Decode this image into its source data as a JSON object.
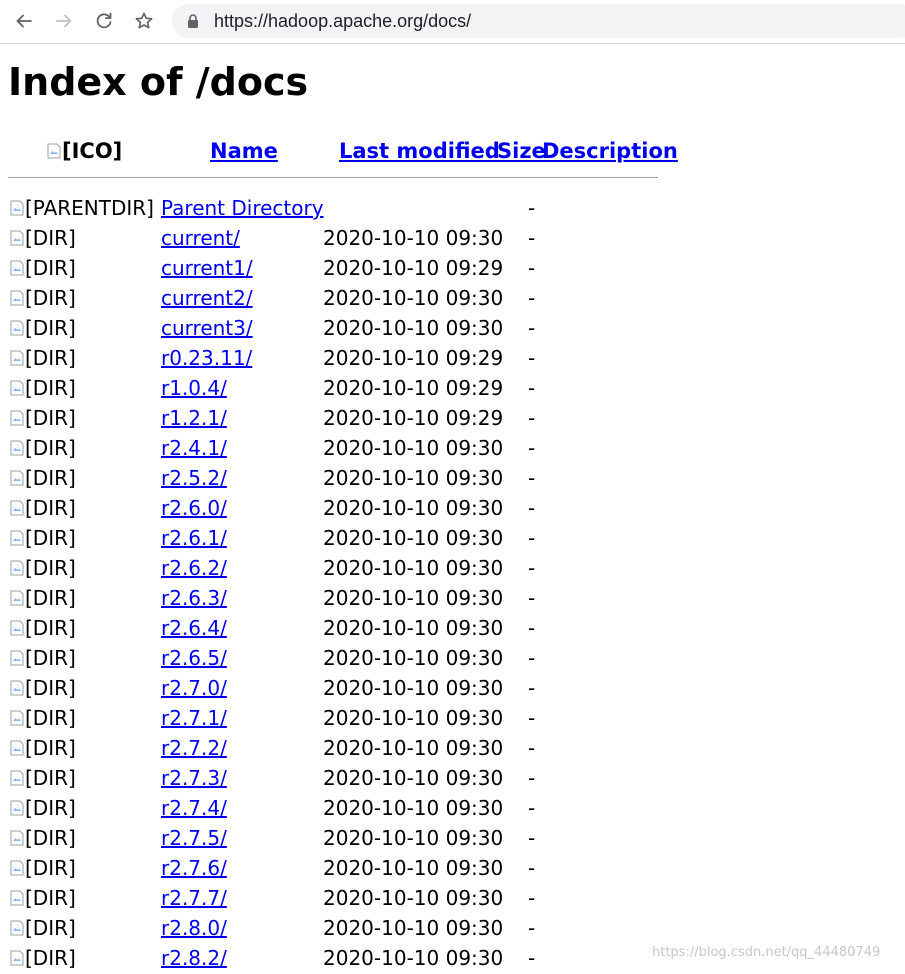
{
  "browser": {
    "url": "https://hadoop.apache.org/docs/"
  },
  "page": {
    "title": "Index of /docs",
    "header": {
      "icon_alt": "[ICO]",
      "name": "Name",
      "last_modified": "Last modified",
      "size": "Size",
      "description": "Description"
    },
    "rows": [
      {
        "icon": "[PARENTDIR]",
        "name": "Parent Directory",
        "date": "",
        "size": "-"
      },
      {
        "icon": "[DIR]",
        "name": "current/",
        "date": "2020-10-10 09:30",
        "size": "-"
      },
      {
        "icon": "[DIR]",
        "name": "current1/",
        "date": "2020-10-10 09:29",
        "size": "-"
      },
      {
        "icon": "[DIR]",
        "name": "current2/",
        "date": "2020-10-10 09:30",
        "size": "-"
      },
      {
        "icon": "[DIR]",
        "name": "current3/",
        "date": "2020-10-10 09:30",
        "size": "-"
      },
      {
        "icon": "[DIR]",
        "name": "r0.23.11/",
        "date": "2020-10-10 09:29",
        "size": "-"
      },
      {
        "icon": "[DIR]",
        "name": "r1.0.4/",
        "date": "2020-10-10 09:29",
        "size": "-"
      },
      {
        "icon": "[DIR]",
        "name": "r1.2.1/",
        "date": "2020-10-10 09:29",
        "size": "-"
      },
      {
        "icon": "[DIR]",
        "name": "r2.4.1/",
        "date": "2020-10-10 09:30",
        "size": "-"
      },
      {
        "icon": "[DIR]",
        "name": "r2.5.2/",
        "date": "2020-10-10 09:30",
        "size": "-"
      },
      {
        "icon": "[DIR]",
        "name": "r2.6.0/",
        "date": "2020-10-10 09:30",
        "size": "-"
      },
      {
        "icon": "[DIR]",
        "name": "r2.6.1/",
        "date": "2020-10-10 09:30",
        "size": "-"
      },
      {
        "icon": "[DIR]",
        "name": "r2.6.2/",
        "date": "2020-10-10 09:30",
        "size": "-"
      },
      {
        "icon": "[DIR]",
        "name": "r2.6.3/",
        "date": "2020-10-10 09:30",
        "size": "-"
      },
      {
        "icon": "[DIR]",
        "name": "r2.6.4/",
        "date": "2020-10-10 09:30",
        "size": "-"
      },
      {
        "icon": "[DIR]",
        "name": "r2.6.5/",
        "date": "2020-10-10 09:30",
        "size": "-"
      },
      {
        "icon": "[DIR]",
        "name": "r2.7.0/",
        "date": "2020-10-10 09:30",
        "size": "-"
      },
      {
        "icon": "[DIR]",
        "name": "r2.7.1/",
        "date": "2020-10-10 09:30",
        "size": "-"
      },
      {
        "icon": "[DIR]",
        "name": "r2.7.2/",
        "date": "2020-10-10 09:30",
        "size": "-"
      },
      {
        "icon": "[DIR]",
        "name": "r2.7.3/",
        "date": "2020-10-10 09:30",
        "size": "-"
      },
      {
        "icon": "[DIR]",
        "name": "r2.7.4/",
        "date": "2020-10-10 09:30",
        "size": "-"
      },
      {
        "icon": "[DIR]",
        "name": "r2.7.5/",
        "date": "2020-10-10 09:30",
        "size": "-"
      },
      {
        "icon": "[DIR]",
        "name": "r2.7.6/",
        "date": "2020-10-10 09:30",
        "size": "-"
      },
      {
        "icon": "[DIR]",
        "name": "r2.7.7/",
        "date": "2020-10-10 09:30",
        "size": "-"
      },
      {
        "icon": "[DIR]",
        "name": "r2.8.0/",
        "date": "2020-10-10 09:30",
        "size": "-"
      },
      {
        "icon": "[DIR]",
        "name": "r2.8.2/",
        "date": "2020-10-10 09:30",
        "size": "-"
      }
    ]
  },
  "watermark": "https://blog.csdn.net/qq_44480749"
}
